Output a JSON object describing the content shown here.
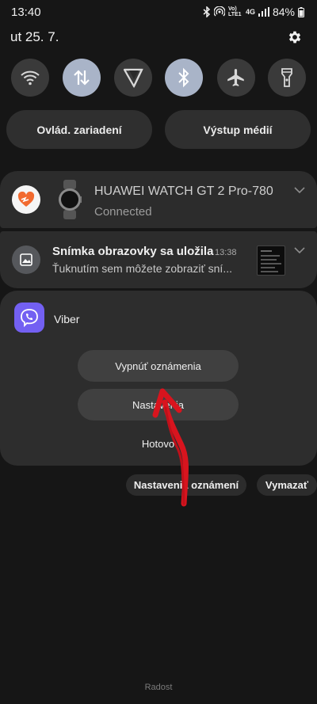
{
  "status_bar": {
    "time": "13:40",
    "volte_label": "Vo) LTE1",
    "network_label": "4G",
    "battery": "84%"
  },
  "panel": {
    "date": "ut 25. 7.",
    "tiles": [
      {
        "name": "wifi-icon",
        "active": false
      },
      {
        "name": "mobile-data-icon",
        "active": true
      },
      {
        "name": "location-icon",
        "active": false
      },
      {
        "name": "bluetooth-icon",
        "active": true
      },
      {
        "name": "airplane-mode-icon",
        "active": false
      },
      {
        "name": "flashlight-icon",
        "active": false
      }
    ],
    "device_control_label": "Ovlád. zariadení",
    "media_output_label": "Výstup médií"
  },
  "notifications": {
    "watch": {
      "title": "HUAWEI WATCH GT 2 Pro-780",
      "status": "Connected"
    },
    "screenshot": {
      "title": "Snímka obrazovky sa uložila",
      "time": "13:38",
      "body": "Ťuknutím sem môžete zobraziť sní..."
    },
    "viber": {
      "app_name": "Viber",
      "turn_off_label": "Vypnúť oznámenia",
      "settings_label": "Nastavenia",
      "done_label": "Hotovo"
    }
  },
  "footer": {
    "notification_settings_label": "Nastavenia oznámení",
    "clear_label": "Vymazať",
    "carrier": "Radost"
  },
  "colors": {
    "background": "#161616",
    "card": "#2c2c2c",
    "tile_active": "#a9b4c8",
    "viber_purple": "#7360f2",
    "annotation_arrow": "#d8141e"
  }
}
